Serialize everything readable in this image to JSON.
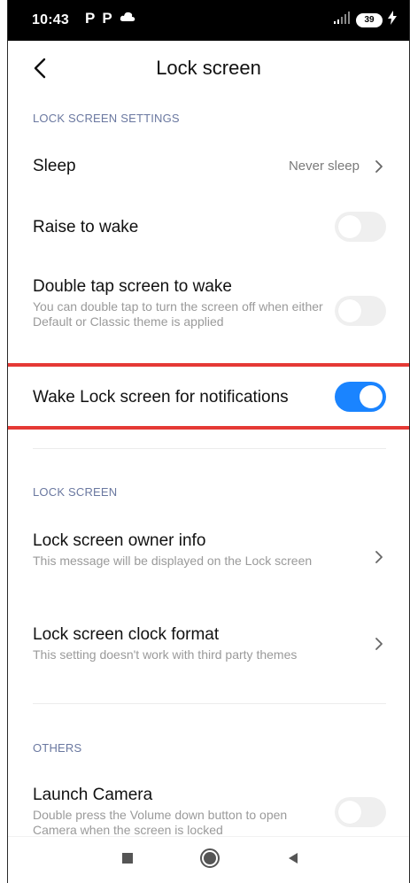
{
  "status_bar": {
    "time": "10:43",
    "left_icons": [
      "P",
      "P",
      "cloud-icon"
    ],
    "battery_level": "39",
    "charging": true
  },
  "header": {
    "title": "Lock screen"
  },
  "sections": {
    "lock_screen_settings": {
      "header": "LOCK SCREEN SETTINGS",
      "sleep": {
        "label": "Sleep",
        "value": "Never sleep"
      },
      "raise_to_wake": {
        "label": "Raise to wake",
        "enabled": false
      },
      "double_tap": {
        "label": "Double tap screen to wake",
        "description": "You can double tap to turn the screen off when either Default or Classic theme is applied",
        "enabled": false
      },
      "wake_lock_notifications": {
        "label": "Wake Lock screen for notifications",
        "enabled": true
      }
    },
    "lock_screen": {
      "header": "LOCK SCREEN",
      "owner_info": {
        "label": "Lock screen owner info",
        "description": "This message will be displayed on the Lock screen"
      },
      "clock_format": {
        "label": "Lock screen clock format",
        "description": "This setting doesn't work with third party themes"
      }
    },
    "others": {
      "header": "OTHERS",
      "launch_camera": {
        "label": "Launch Camera",
        "description": "Double press the Volume down button to open Camera when the screen is locked",
        "enabled": false
      }
    }
  },
  "colors": {
    "accent": "#1a84ff",
    "section_header": "#6a78a0",
    "highlight": "#e53935"
  },
  "navbar": {
    "buttons": [
      "recents-square-icon",
      "home-circle-icon",
      "back-triangle-icon"
    ]
  }
}
